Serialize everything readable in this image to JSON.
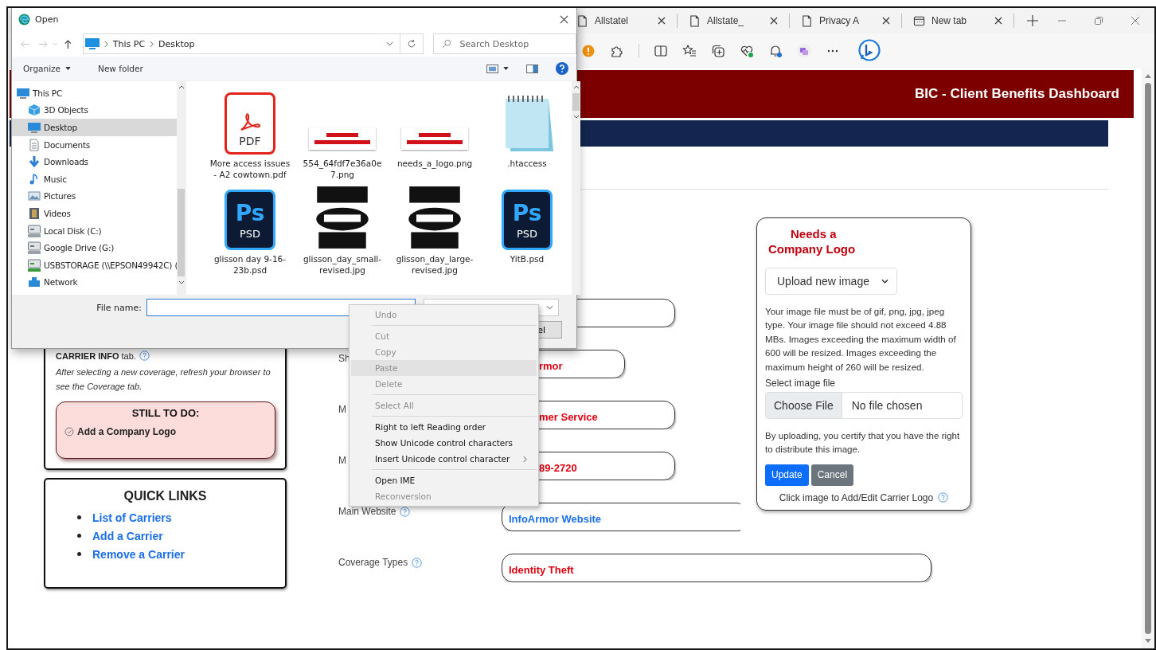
{
  "browser": {
    "tabs": [
      {
        "title": "Allstatel",
        "selected": false,
        "kind": "page"
      },
      {
        "title": "Allstate_",
        "selected": false,
        "kind": "page"
      },
      {
        "title": "Privacy A",
        "selected": false,
        "kind": "page"
      },
      {
        "title": "New tab",
        "selected": false,
        "kind": "newtab"
      }
    ]
  },
  "page": {
    "header_title": "BIC - Client Benefits Dashboard",
    "carrier_card": {
      "note": "**CARRIER INFO** tab.",
      "hint": "After selecting a new coverage, refresh your browser to see the Coverage tab.",
      "todo_title": "STILL TO DO:",
      "todo_items": [
        "Add a Company Logo"
      ]
    },
    "quick_links": {
      "title": "QUICK LINKS",
      "links": [
        "List of Carriers",
        "Add a Carrier",
        "Remove a Carrier"
      ]
    },
    "fields": [
      {
        "kind": "text",
        "help": false
      },
      {
        "kind": "text",
        "label": "Sh",
        "value": "rmor",
        "help": false
      },
      {
        "kind": "text",
        "label": "M",
        "value": "mer Service",
        "help": false
      },
      {
        "kind": "text",
        "label": "M",
        "value": "89-2720",
        "help": false
      },
      {
        "kind": "link",
        "label": "Main Website",
        "value": "InfoArmor Website",
        "help": true
      },
      {
        "kind": "text",
        "label": "Coverage Types",
        "value": "Identity Theft",
        "help": true
      }
    ],
    "logo_card": {
      "logo_lines": [
        "Needs a",
        "Company Logo"
      ],
      "source_select": "Upload new image",
      "requirements": "Your image file must be of gif, png, jpg, jpeg type. Your image file should not exceed 4.88 MBs. Images exceeding the maximum width of 600 will be resized. Images exceeding the maximum height of 260 will be resized.",
      "file_label": "Select image file",
      "choose_button": "Choose File",
      "file_status": "No file chosen",
      "certify": "By uploading, you certify that you have the right to distribute this image.",
      "update_button": "Update",
      "cancel_button": "Cancel",
      "caption": "Click image to Add/Edit Carrier Logo"
    }
  },
  "dialog": {
    "title": "Open",
    "breadcrumb": [
      "This PC",
      "Desktop"
    ],
    "search_placeholder": "Search Desktop",
    "organize": "Organize",
    "new_folder": "New folder",
    "nav": [
      {
        "label": "This PC",
        "kind": "pc",
        "selected": false
      },
      {
        "label": "3D Objects",
        "kind": "cube",
        "selected": false
      },
      {
        "label": "Desktop",
        "kind": "desktop",
        "selected": true
      },
      {
        "label": "Documents",
        "kind": "documents",
        "selected": false
      },
      {
        "label": "Downloads",
        "kind": "downloads",
        "selected": false
      },
      {
        "label": "Music",
        "kind": "music",
        "selected": false
      },
      {
        "label": "Pictures",
        "kind": "pictures",
        "selected": false
      },
      {
        "label": "Videos",
        "kind": "videos",
        "selected": false
      },
      {
        "label": "Local Disk (C:)",
        "kind": "disk",
        "selected": false
      },
      {
        "label": "Google Drive (G:)",
        "kind": "drive",
        "selected": false
      },
      {
        "label": "USBSTORAGE (\\\\EPSON49942C) (",
        "kind": "netdrive",
        "selected": false
      },
      {
        "label": "Network",
        "kind": "network",
        "selected": false
      }
    ],
    "files": [
      {
        "name": "More access issues - A2 cowtown.pdf",
        "kind": "pdf",
        "badge": "PDF"
      },
      {
        "name": "554_64fdf7e36a0e7.png",
        "kind": "logo"
      },
      {
        "name": "needs_a_logo.png",
        "kind": "logo"
      },
      {
        "name": ".htaccess",
        "kind": "notepad"
      },
      {
        "name": "glisson day 9-16-23b.psd",
        "kind": "psd",
        "badge": "PSD",
        "mark": "Ps"
      },
      {
        "name": "glisson_day_small-revised.jpg",
        "kind": "photo"
      },
      {
        "name": "glisson_day_large-revised.jpg",
        "kind": "photo"
      },
      {
        "name": "YitB.psd",
        "kind": "psd",
        "badge": "PSD",
        "mark": "Ps"
      }
    ],
    "file_name_label": "File name:",
    "cancel_partial": "el"
  },
  "context_menu": {
    "items": [
      {
        "kind": "command",
        "label": "Undo",
        "disabled": true,
        "selected": false,
        "has_submenu": false
      },
      {
        "kind": "separator"
      },
      {
        "kind": "command",
        "label": "Cut",
        "disabled": true,
        "selected": false,
        "has_submenu": false
      },
      {
        "kind": "command",
        "label": "Copy",
        "disabled": true,
        "selected": false,
        "has_submenu": false
      },
      {
        "kind": "command",
        "label": "Paste",
        "disabled": true,
        "selected": true,
        "has_submenu": false
      },
      {
        "kind": "command",
        "label": "Delete",
        "disabled": true,
        "selected": false,
        "has_submenu": false
      },
      {
        "kind": "separator"
      },
      {
        "kind": "command",
        "label": "Select All",
        "disabled": true,
        "selected": false,
        "has_submenu": false
      },
      {
        "kind": "separator"
      },
      {
        "kind": "command",
        "label": "Right to left Reading order",
        "disabled": false,
        "selected": false,
        "has_submenu": false
      },
      {
        "kind": "command",
        "label": "Show Unicode control characters",
        "disabled": false,
        "selected": false,
        "has_submenu": false
      },
      {
        "kind": "command",
        "label": "Insert Unicode control character",
        "disabled": false,
        "selected": false,
        "has_submenu": true
      },
      {
        "kind": "separator"
      },
      {
        "kind": "command",
        "label": "Open IME",
        "disabled": false,
        "selected": false,
        "has_submenu": false
      },
      {
        "kind": "command",
        "label": "Reconversion",
        "disabled": true,
        "selected": false,
        "has_submenu": false
      }
    ]
  }
}
